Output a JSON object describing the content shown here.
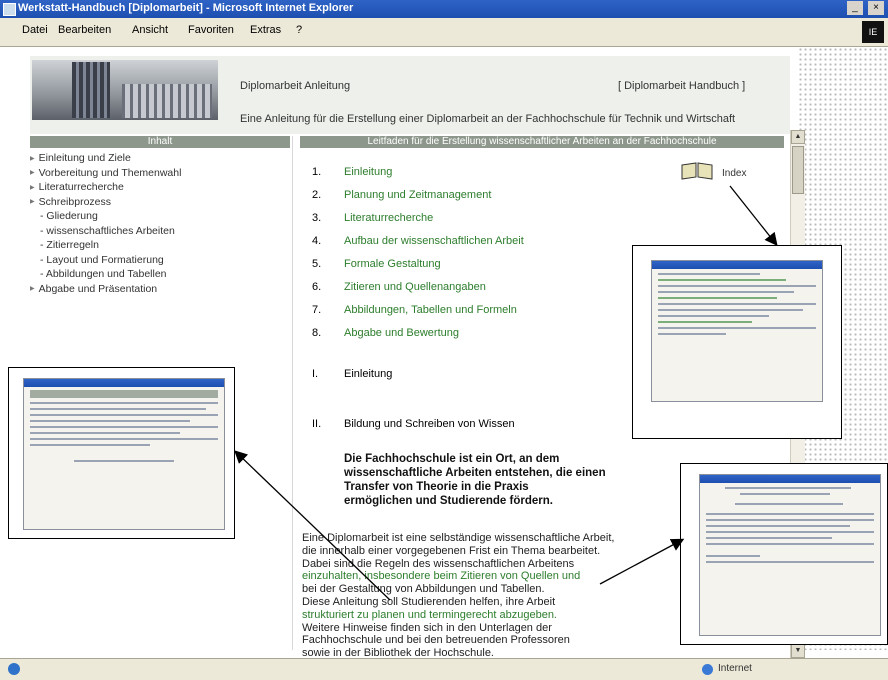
{
  "window": {
    "title": "Werkstatt-Handbuch [Diplomarbeit] - Microsoft Internet Explorer",
    "controls": {
      "minimize": "_",
      "close": "×"
    }
  },
  "menubar": {
    "items": [
      "Datei",
      "Bearbeiten",
      "Ansicht",
      "Favoriten",
      "Extras",
      "?"
    ],
    "throbber": "IE"
  },
  "header": {
    "left_text": "Diplomarbeit Anleitung",
    "right_text": "[ Diplomarbeit Handbuch ]",
    "subtitle": "Eine Anleitung für die Erstellung einer Diplomarbeit an der Fachhochschule für Technik und Wirtschaft"
  },
  "nav": {
    "heading": "Inhalt",
    "items": [
      {
        "label": "Einleitung und Ziele",
        "level": 1
      },
      {
        "label": "Vorbereitung und Themenwahl",
        "level": 1
      },
      {
        "label": "Literaturrecherche",
        "level": 1
      },
      {
        "label": "Schreibprozess",
        "level": 1
      },
      {
        "label": "Gliederung",
        "level": 2
      },
      {
        "label": "wissenschaftliches Arbeiten",
        "level": 2
      },
      {
        "label": "Zitierregeln",
        "level": 2
      },
      {
        "label": "Layout und Formatierung",
        "level": 2
      },
      {
        "label": "Abbildungen und Tabellen",
        "level": 2
      },
      {
        "label": "Abgabe und Präsentation",
        "level": 1
      }
    ]
  },
  "main": {
    "heading": "Leitfaden für die Erstellung wissenschaftlicher Arbeiten an der Fachhochschule",
    "book_label": "Index",
    "toc": [
      {
        "num": "1.",
        "label": "Einleitung"
      },
      {
        "num": "2.",
        "label": "Planung und Zeitmanagement"
      },
      {
        "num": "3.",
        "label": "Literaturrecherche"
      },
      {
        "num": "4.",
        "label": "Aufbau der wissenschaftlichen Arbeit"
      },
      {
        "num": "5.",
        "label": "Formale Gestaltung"
      },
      {
        "num": "6.",
        "label": "Zitieren und Quellenangaben"
      },
      {
        "num": "7.",
        "label": "Abbildungen, Tabellen und Formeln"
      },
      {
        "num": "8.",
        "label": "Abgabe und Bewertung"
      }
    ],
    "sections": [
      {
        "num": "I.",
        "label": "Einleitung"
      },
      {
        "num": "II.",
        "label": "Bildung und Schreiben von Wissen"
      }
    ],
    "quote": [
      "Die Fachhochschule ist ein Ort, an dem",
      "wissenschaftliche Arbeiten entstehen, die einen",
      "Transfer von Theorie in die Praxis",
      "ermöglichen und Studierende fördern."
    ],
    "body": [
      "Eine Diplomarbeit ist eine selbständige wissenschaftliche Arbeit,",
      "die innerhalb einer vorgegebenen Frist ein Thema bearbeitet.",
      "Dabei sind die Regeln des wissenschaftlichen Arbeitens",
      "einzuhalten, insbesondere beim Zitieren von Quellen und",
      "bei der Gestaltung von Abbildungen und Tabellen.",
      "Diese Anleitung soll Studierenden helfen, ihre Arbeit",
      "strukturiert zu planen und termingerecht abzugeben.",
      "Weitere Hinweise finden sich in den Unterlagen der",
      "Fachhochschule und bei den betreuenden Professoren",
      "sowie in der Bibliothek der Hochschule."
    ]
  },
  "status": {
    "zone": "Internet"
  }
}
